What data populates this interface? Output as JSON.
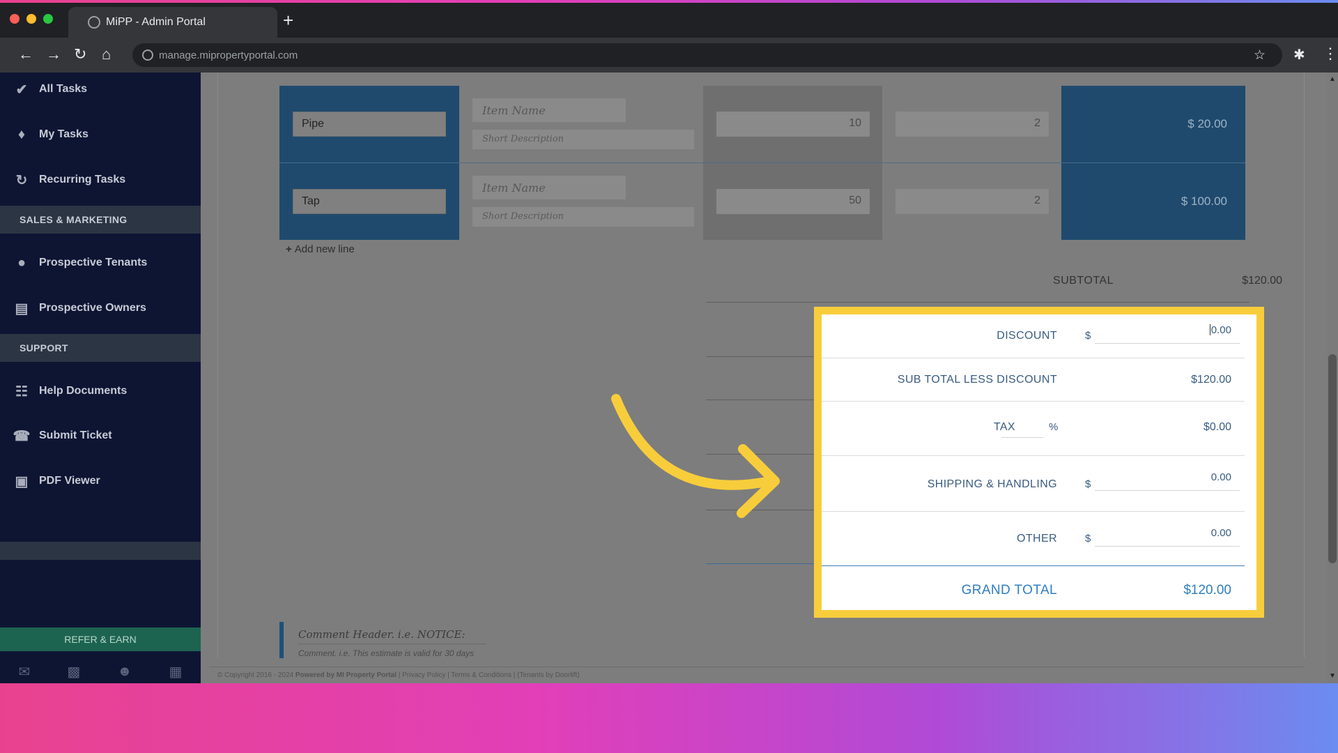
{
  "browser": {
    "tab_title": "MiPP - Admin Portal",
    "new_tab": "+",
    "url": "manage.mipropertyportal.com"
  },
  "sidebar": {
    "items_top": [
      {
        "label": "All Tasks",
        "icon": "check-icon"
      },
      {
        "label": "My Tasks",
        "icon": "tag-icon"
      },
      {
        "label": "Recurring Tasks",
        "icon": "refresh-icon"
      }
    ],
    "section_sales": "SALES & MARKETING",
    "items_sales": [
      {
        "label": "Prospective Tenants",
        "icon": "users-icon"
      },
      {
        "label": "Prospective Owners",
        "icon": "id-card-icon"
      }
    ],
    "section_support": "SUPPORT",
    "items_support": [
      {
        "label": "Help Documents",
        "icon": "book-icon"
      },
      {
        "label": "Submit Ticket",
        "icon": "headset-icon"
      },
      {
        "label": "PDF Viewer",
        "icon": "pdf-icon"
      }
    ],
    "refer": "REFER & EARN",
    "bottom_icons": [
      "mail-icon",
      "briefcase-icon",
      "user-icon",
      "calculator-icon"
    ]
  },
  "line_items": [
    {
      "name": "Pipe",
      "item_placeholder": "Item Name",
      "desc_placeholder": "Short Description",
      "qty": "10",
      "rate": "2",
      "amount": "$ 20.00"
    },
    {
      "name": "Tap",
      "item_placeholder": "Item Name",
      "desc_placeholder": "Short Description",
      "qty": "50",
      "rate": "2",
      "amount": "$ 100.00"
    }
  ],
  "add_line": "Add new line",
  "subtotal": {
    "label": "SUBTOTAL",
    "value": "$120.00"
  },
  "totals": {
    "discount_label": "DISCOUNT",
    "currency": "$",
    "discount_value": "0.00",
    "sub_less_label": "SUB TOTAL LESS DISCOUNT",
    "sub_less_value": "$120.00",
    "tax_label": "TAX",
    "tax_pct": "%",
    "tax_value": "$0.00",
    "shipping_label": "SHIPPING & HANDLING",
    "shipping_value": "0.00",
    "other_label": "OTHER",
    "other_value": "0.00",
    "grand_label": "GRAND TOTAL",
    "grand_value": "$120.00"
  },
  "comment": {
    "header_placeholder": "Comment Header. i.e. NOTICE:",
    "body_placeholder": "Comment. i.e. This estimate is valid for 30 days"
  },
  "footer": {
    "copyright": "© Copyright 2016 - 2024",
    "powered": "Powered by MI Property Portal",
    "links": "| Privacy Policy | Terms & Conditions |",
    "tenants": "(Tenants by Doorlift)"
  },
  "colors": {
    "highlight": "#f8cd3b",
    "sidebar": "#0e1533",
    "accent_blue": "#2f7fc1"
  }
}
